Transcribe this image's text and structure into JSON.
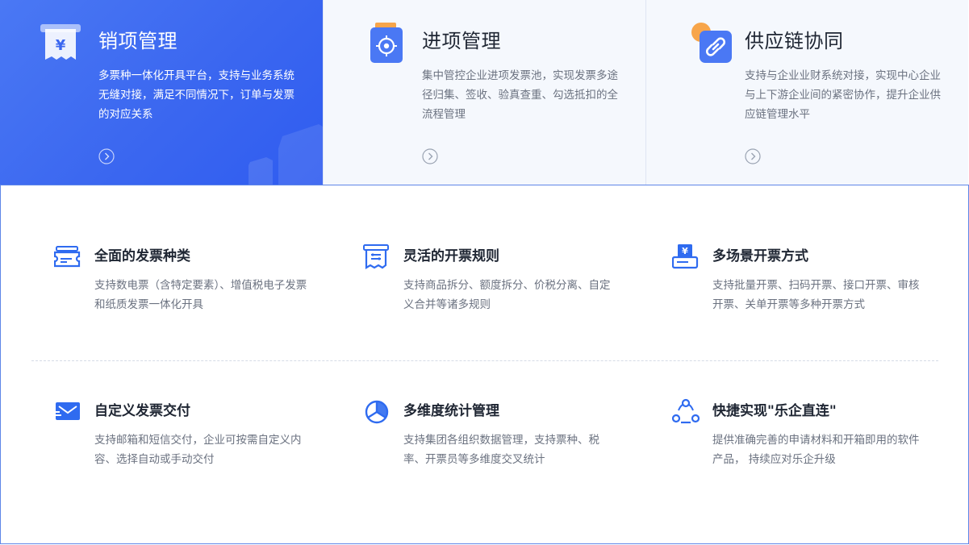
{
  "tabs": [
    {
      "title": "销项管理",
      "desc": "多票种一体化开具平台，支持与业务系统无缝对接，满足不同情况下，订单与发票的对应关系",
      "icon": "receipt-yen-icon",
      "arrow_icon": "arrow-right-circle-icon",
      "active": true
    },
    {
      "title": "进项管理",
      "desc": "集中管控企业进项发票池，实现发票多途径归集、签收、验真查重、勾选抵扣的全流程管理",
      "icon": "target-file-icon",
      "arrow_icon": "arrow-right-circle-icon",
      "active": false
    },
    {
      "title": "供应链协同",
      "desc": "支持与企业业财系统对接，实现中心企业与上下游企业间的紧密协作，提升企业供应链管理水平",
      "icon": "link-icon",
      "arrow_icon": "arrow-right-circle-icon",
      "active": false
    }
  ],
  "features": [
    {
      "title": "全面的发票种类",
      "desc": "支持数电票（含特定要素）、增值税电子发票和纸质发票一体化开具",
      "icon": "ticket-icon"
    },
    {
      "title": "灵活的开票规则",
      "desc": "支持商品拆分、额度拆分、价税分离、自定义合并等诸多规则",
      "icon": "rules-receipt-icon"
    },
    {
      "title": "多场景开票方式",
      "desc": "支持批量开票、扫码开票、接口开票、审核开票、关单开票等多种开票方式",
      "icon": "printer-yen-icon"
    },
    {
      "title": "自定义发票交付",
      "desc": "支持邮箱和短信交付，企业可按需自定义内容、选择自动或手动交付",
      "icon": "mail-icon"
    },
    {
      "title": "多维度统计管理",
      "desc": "支持集团各组织数据管理，支持票种、税率、开票员等多维度交叉统计",
      "icon": "pie-chart-icon"
    },
    {
      "title": "快捷实现\"乐企直连\"",
      "desc": "提供准确完善的申请材料和开箱即用的软件产品， 持续应对乐企升级",
      "icon": "network-nodes-icon"
    }
  ],
  "colors": {
    "accent": "#3b67f0",
    "orange": "#f7a54a",
    "text": "#1f2633",
    "muted": "#6b7280"
  }
}
